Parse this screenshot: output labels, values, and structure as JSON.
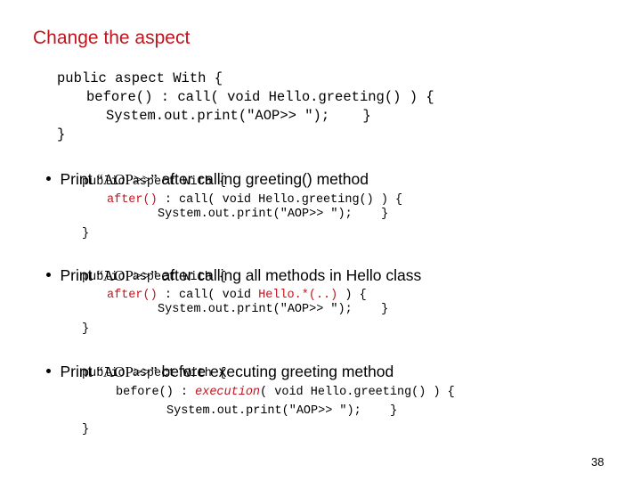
{
  "slide": {
    "title": "Change the aspect",
    "page_number": "38",
    "accent_color": "#c0151f"
  },
  "block0": {
    "lines": [
      "public aspect With {",
      "before() : call( void Hello.greeting() ) {",
      "System.out.print(\"AOP>> \");    }",
      "}"
    ]
  },
  "bullets": [
    {
      "prefix": "Print ",
      "quoted": "“AOP>>”",
      "suffix": " after calling greeting() method",
      "code": {
        "line1": "public aspect With {",
        "advice": "after()",
        "line2_rest": " : call( void Hello.greeting() ) {",
        "line3": "System.out.print(\"AOP>> \");    }",
        "line4": "}"
      }
    },
    {
      "prefix": "Print ",
      "quoted": "“AOP>>”",
      "suffix": " after calling all methods in Hello class",
      "code": {
        "line1": "public aspect With {",
        "advice": "after()",
        "line2_mid": " : call( void ",
        "pattern": "Hello.*(..)",
        "line2_end": " ) {",
        "line3": "System.out.print(\"AOP>> \");    }",
        "line4": "}"
      }
    },
    {
      "prefix": "Print ",
      "quoted": "“AOP>>”",
      "suffix": " before executing greeting method",
      "code": {
        "line1": "public aspect With {",
        "line2_start": "before() : ",
        "pointcut": "execution",
        "line2_rest": "( void Hello.greeting() ) {",
        "line3": "System.out.print(\"AOP>> \");    }",
        "line4": "}"
      }
    }
  ]
}
